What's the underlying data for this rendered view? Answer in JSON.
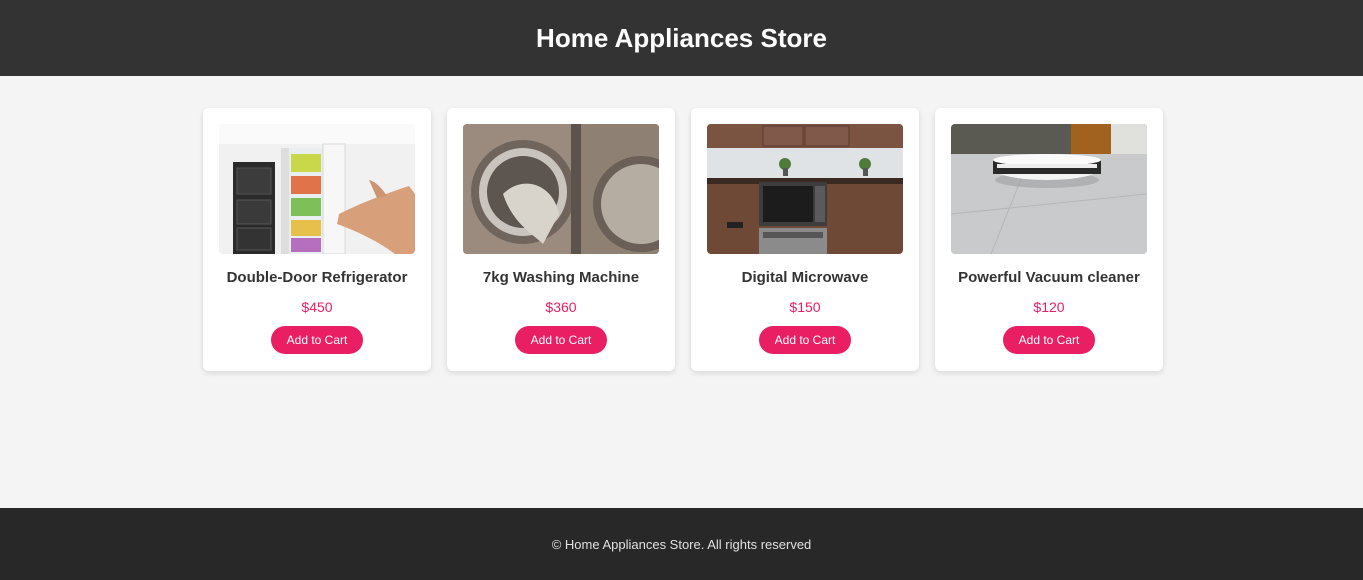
{
  "header": {
    "title": "Home Appliances Store"
  },
  "products": [
    {
      "name": "Double-Door Refrigerator",
      "price": "$450",
      "button": "Add to Cart",
      "image": "refrigerator-photo"
    },
    {
      "name": "7kg Washing Machine",
      "price": "$360",
      "button": "Add to Cart",
      "image": "washing-machine-photo"
    },
    {
      "name": "Digital Microwave",
      "price": "$150",
      "button": "Add to Cart",
      "image": "microwave-photo"
    },
    {
      "name": "Powerful Vacuum cleaner",
      "price": "$120",
      "button": "Add to Cart",
      "image": "robot-vacuum-photo"
    }
  ],
  "footer": {
    "text": "© Home Appliances Store. All rights reserved"
  },
  "colors": {
    "header_bg": "#333333",
    "page_bg": "#f4f4f4",
    "accent": "#e91e63",
    "footer_bg": "#282828"
  }
}
